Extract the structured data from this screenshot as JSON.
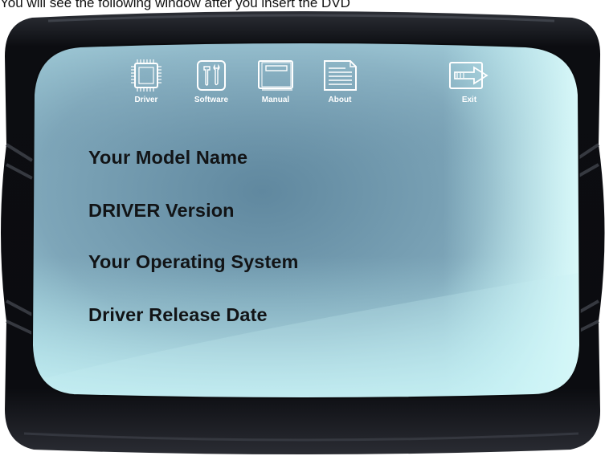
{
  "caption": "You will see the following window after you insert the DVD",
  "toolbar": {
    "items": [
      {
        "id": "driver",
        "label": "Driver",
        "icon": "chip-icon"
      },
      {
        "id": "software",
        "label": "Software",
        "icon": "tools-icon"
      },
      {
        "id": "manual",
        "label": "Manual",
        "icon": "book-icon"
      },
      {
        "id": "about",
        "label": "About",
        "icon": "document-icon"
      },
      {
        "id": "exit",
        "label": "Exit",
        "icon": "exit-arrow-icon"
      }
    ]
  },
  "info": {
    "model_name": "Your Model Name",
    "driver_version": "DRIVER Version",
    "operating_system": "Your Operating System",
    "release_date": "Driver Release Date"
  },
  "colors": {
    "frame": "#0d0e12",
    "panel_center": "#6f93a8",
    "panel_edge": "#bfeef3",
    "icon_stroke": "#ffffff",
    "text": "#121416"
  }
}
